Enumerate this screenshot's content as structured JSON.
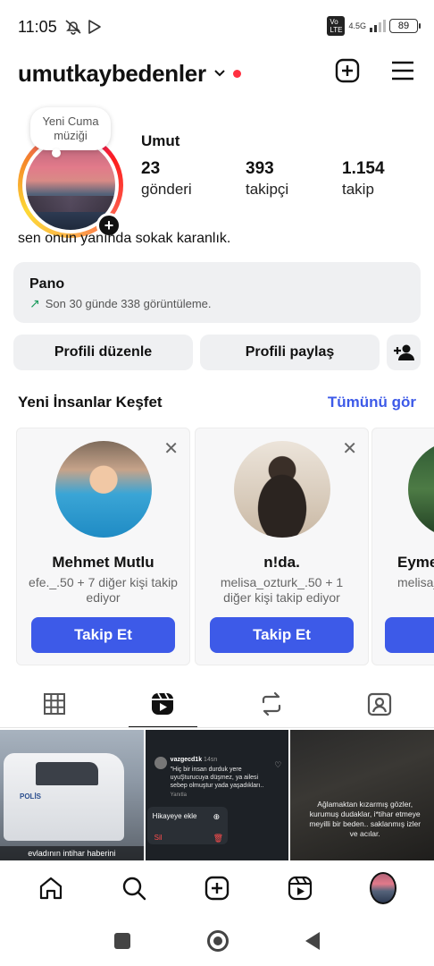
{
  "status_bar": {
    "time": "11:05",
    "network": "4.5G",
    "battery": "89"
  },
  "header": {
    "username": "umutkaybedenler"
  },
  "profile": {
    "note": "Yeni Cuma müziği",
    "display_name": "Umut",
    "stats": [
      {
        "value": "23",
        "label": "gönderi"
      },
      {
        "value": "393",
        "label": "takipçi"
      },
      {
        "value": "1.154",
        "label": "takip"
      }
    ],
    "bio": "sen onun yanında sokak karanlık."
  },
  "dashboard": {
    "title": "Pano",
    "subtitle": "Son 30 günde 338 görüntüleme."
  },
  "buttons": {
    "edit": "Profili düzenle",
    "share": "Profili paylaş"
  },
  "discover": {
    "title": "Yeni İnsanlar Keşfet",
    "see_all": "Tümünü gör",
    "cards": [
      {
        "name": "Mehmet Mutlu",
        "sub": "efe._.50 + 7 diğer kişi takip ediyor",
        "button": "Takip Et"
      },
      {
        "name": "n!da.",
        "sub": "melisa_ozturk_.50 + 1 diğer kişi takip ediyor",
        "button": "Takip Et"
      },
      {
        "name": "Eyme",
        "sub": "melisa_ diğer k",
        "button": "T"
      }
    ]
  },
  "grid": {
    "post1_caption": "evladının intihar haberini",
    "post1_logo": "POLİS",
    "post2_user": "vazgecd1k",
    "post2_time": "14sn",
    "post2_text": "\"Hiç bir insan durduk yere uyuŞturucuya düşmez, ya ailesi sebep olmuştur yada yaşadıkları..",
    "post2_reply": "Yanıtla",
    "post2_menu_add": "Hikayeye ekle",
    "post2_menu_delete": "Sil",
    "post3_text": "Ağlamaktan kızarmış gözler, kurumuş dudaklar, i*tihar etmeye meyilli bir beden.. saklanmış izler ve acılar."
  }
}
